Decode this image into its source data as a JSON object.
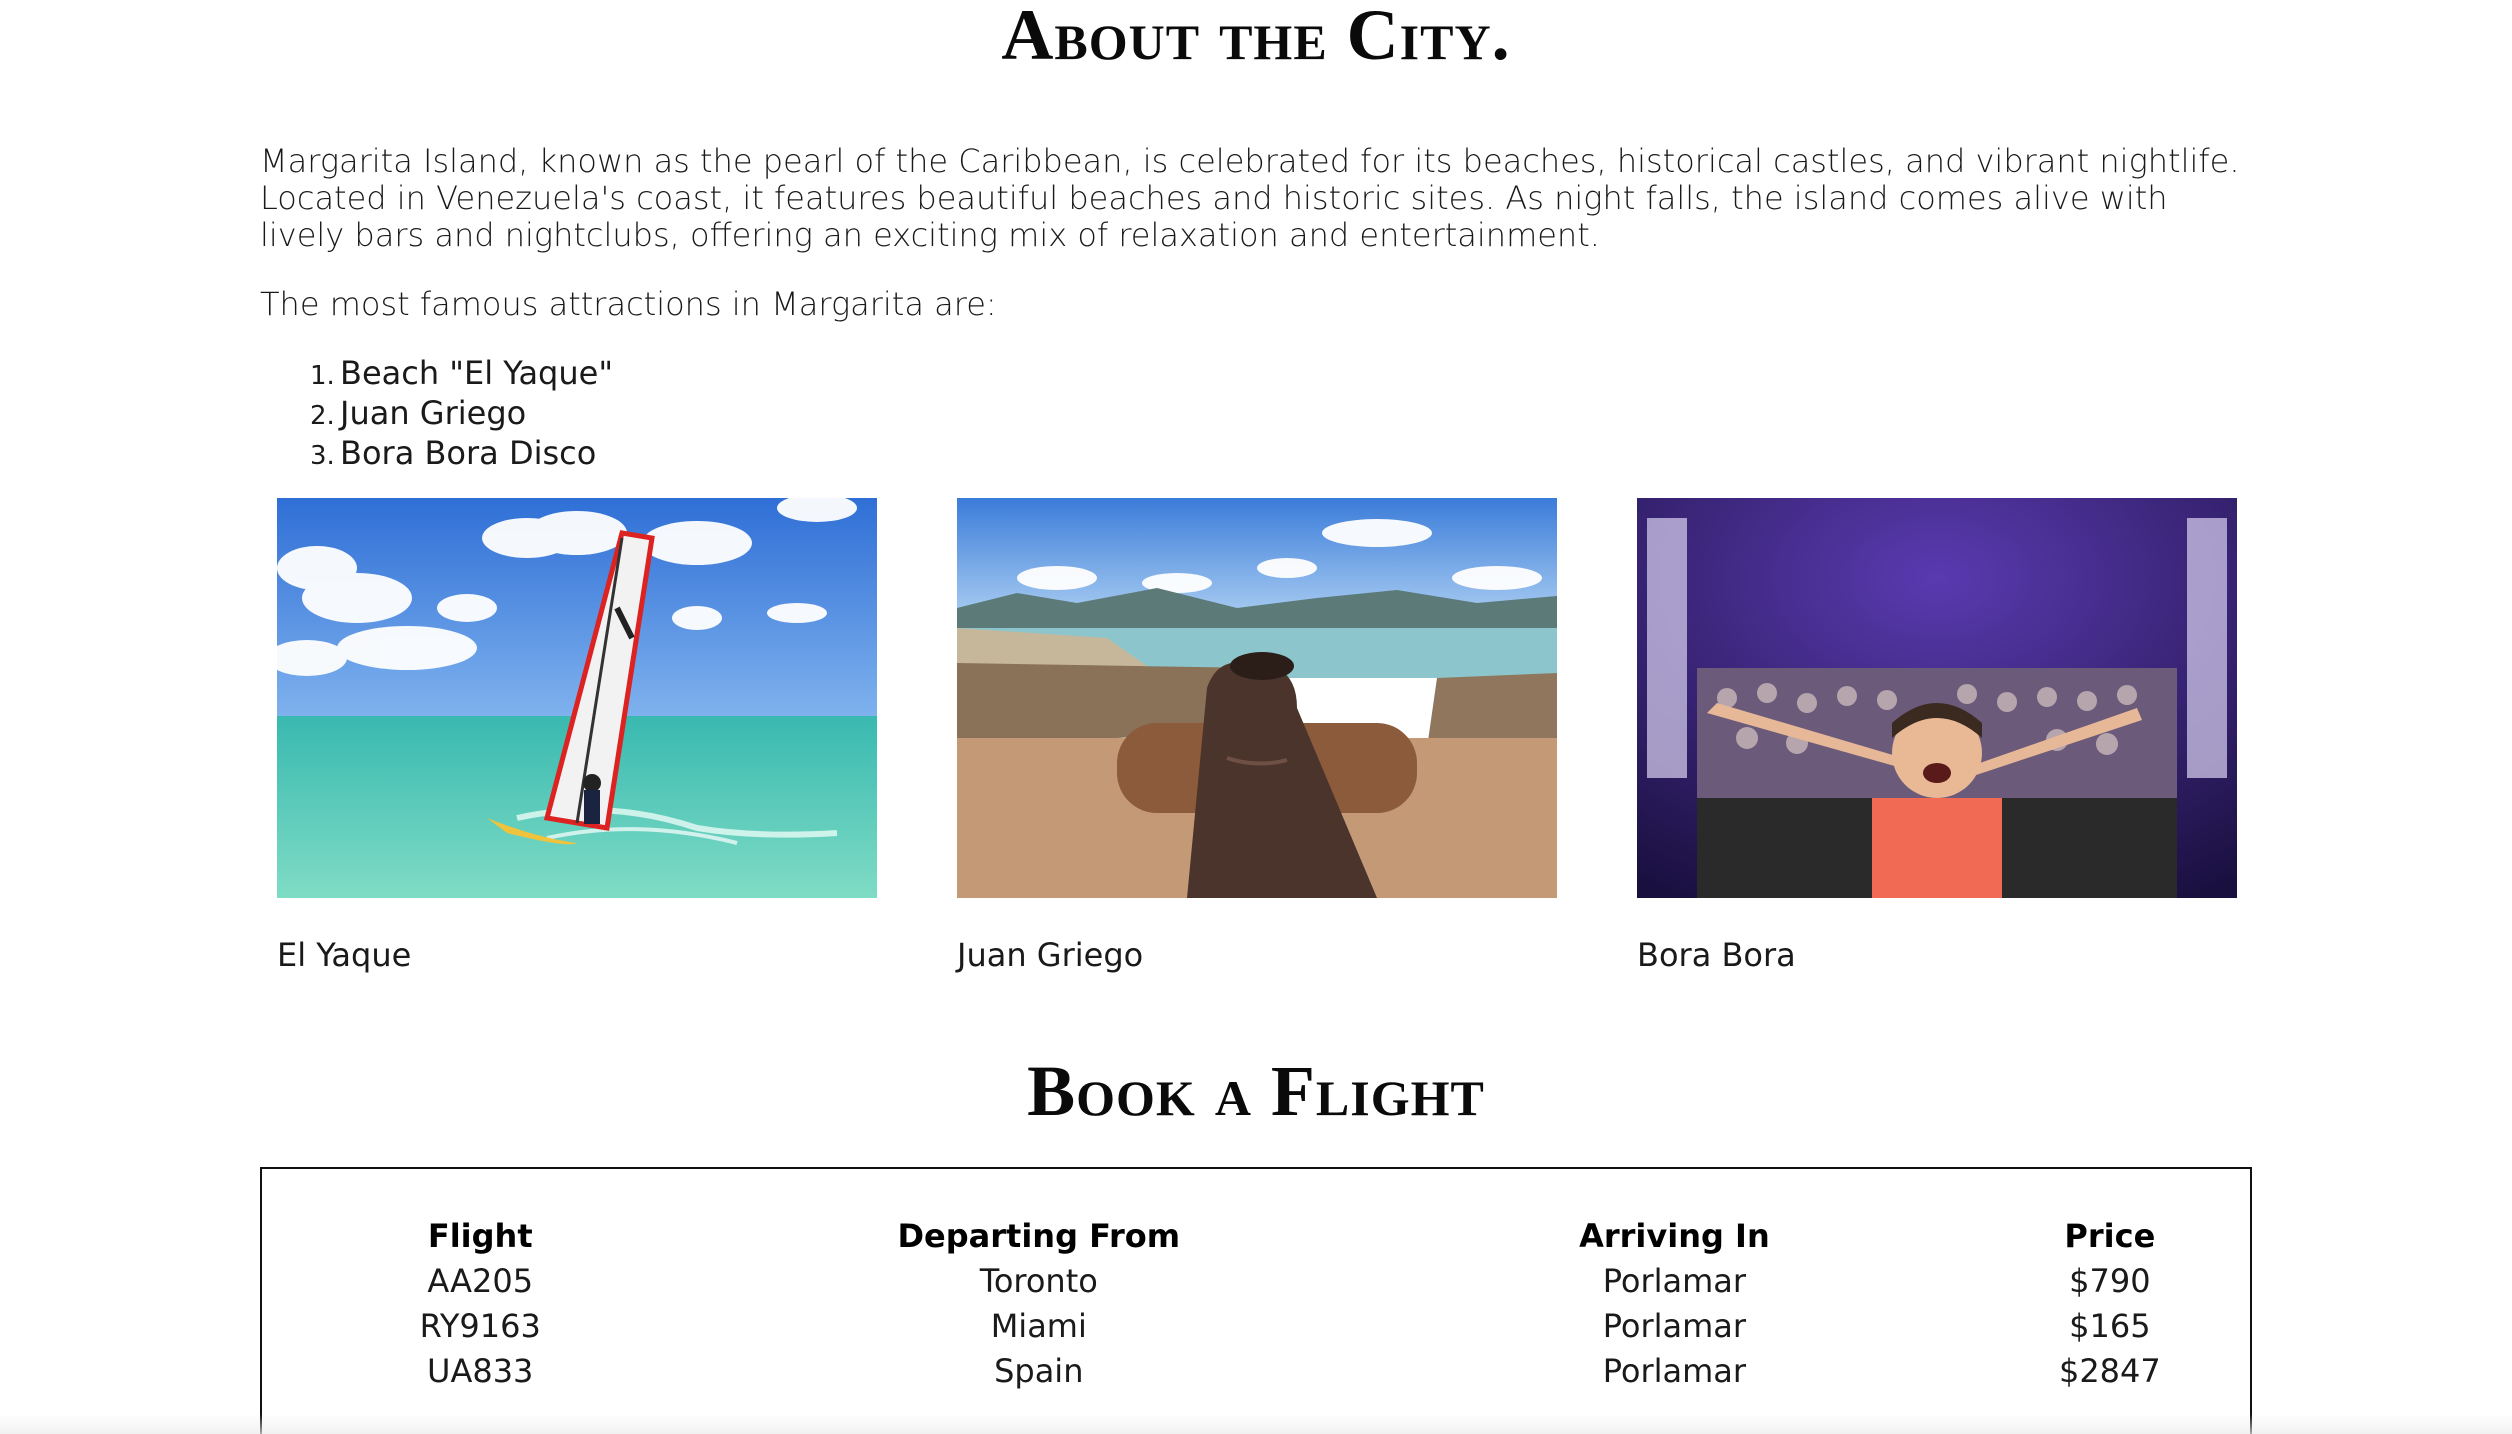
{
  "about": {
    "title": "About the City.",
    "intro": "Margarita Island, known as the pearl of the Caribbean, is celebrated for its beaches, historical castles, and vibrant nightlife. Located in Venezuela's coast, it features beautiful beaches and historic sites. As night falls, the island comes alive with lively bars and nightclubs, offering an exciting mix of relaxation and entertainment.",
    "attractions_heading": "The most famous attractions in Margarita are:",
    "attractions": [
      {
        "num": "1.",
        "label": "Beach \"El Yaque\""
      },
      {
        "num": "2.",
        "label": "Juan Griego"
      },
      {
        "num": "3.",
        "label": "Bora Bora Disco"
      }
    ]
  },
  "gallery": [
    {
      "caption": "El Yaque",
      "image": "windsurfer-photo"
    },
    {
      "caption": "Juan Griego",
      "image": "cannon-fort-photo"
    },
    {
      "caption": "Bora Bora",
      "image": "nightclub-dj-photo"
    }
  ],
  "booking": {
    "title": "Book a Flight",
    "headers": {
      "flight": "Flight",
      "from": "Departing From",
      "to": "Arriving In",
      "price": "Price"
    },
    "rows": [
      {
        "flight": "AA205",
        "from": "Toronto",
        "to": "Porlamar",
        "price": "$790"
      },
      {
        "flight": "RY9163",
        "from": "Miami",
        "to": "Porlamar",
        "price": "$165"
      },
      {
        "flight": "UA833",
        "from": "Spain",
        "to": "Porlamar",
        "price": "$2847"
      }
    ]
  }
}
